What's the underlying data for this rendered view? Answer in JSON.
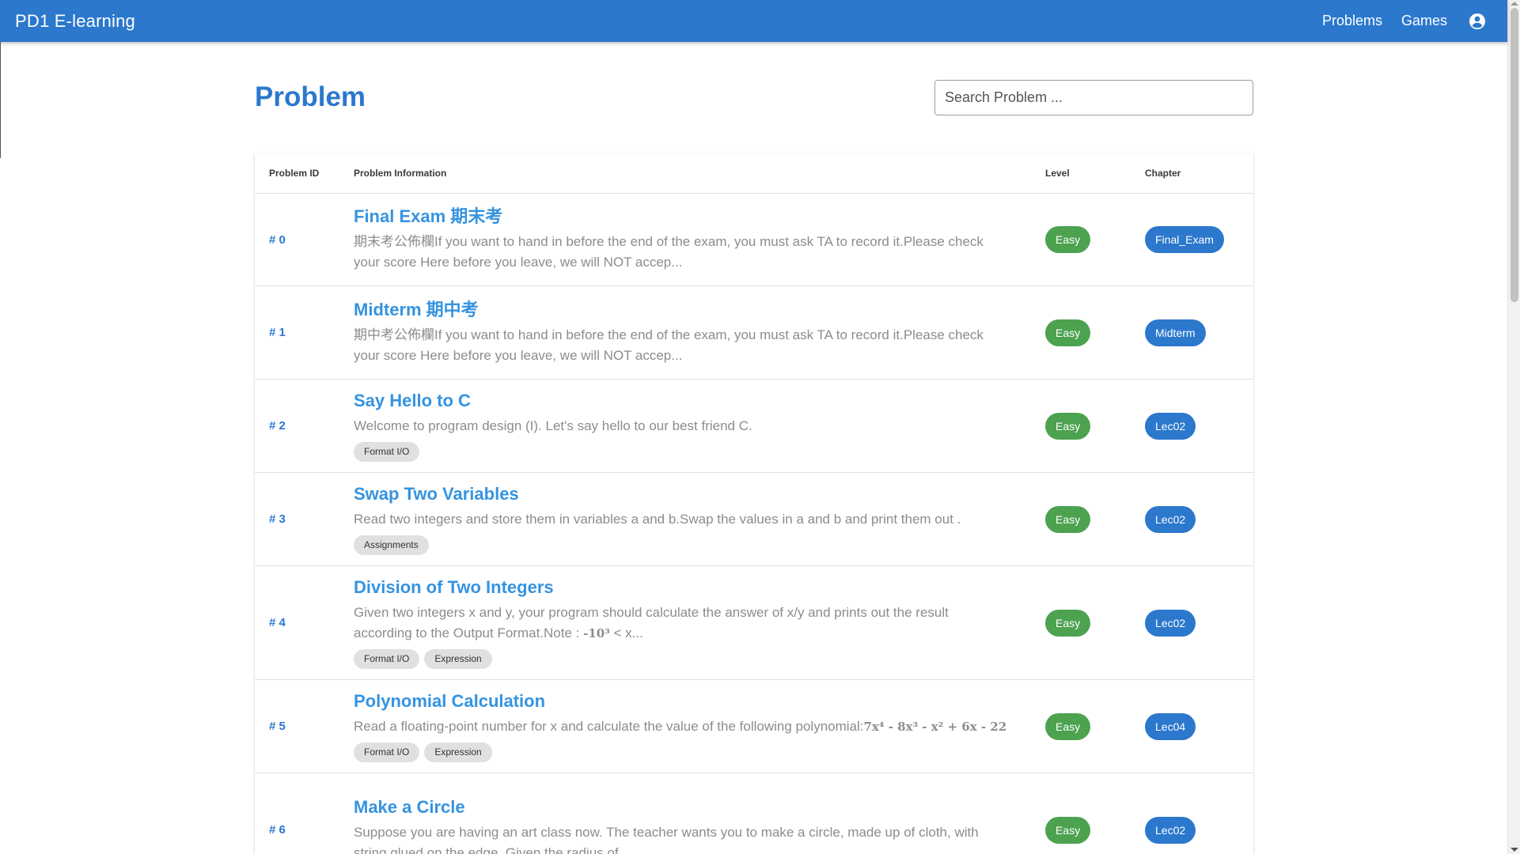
{
  "appbar": {
    "title": "PD1 E-learning",
    "nav": {
      "problems": "Problems",
      "games": "Games"
    },
    "account_icon": "account-circle-icon",
    "bg_color": "#2b78cd"
  },
  "page": {
    "title": "Problem",
    "search": {
      "placeholder": "Search Problem ...",
      "value": ""
    }
  },
  "table": {
    "headers": {
      "id": "Problem ID",
      "info": "Problem Information",
      "level": "Level",
      "chapter": "Chapter"
    },
    "rows": [
      {
        "id": "# 0",
        "title": "Final Exam 期末考",
        "desc": "期末考公佈欄If you want to hand in before the end of the exam, you must ask TA to record it.Please check your score Here before you leave, we will NOT accep...",
        "tags": [],
        "level": "Easy",
        "chapter": "Final_Exam"
      },
      {
        "id": "# 1",
        "title": "Midterm 期中考",
        "desc": "期中考公佈欄If you want to hand in before the end of the exam, you must ask TA to record it.Please check your score Here before you leave, we will NOT accep...",
        "tags": [],
        "level": "Easy",
        "chapter": "Midterm"
      },
      {
        "id": "# 2",
        "title": "Say Hello to C",
        "desc": "Welcome to program design (I). Let's say hello to our best friend C.",
        "tags": [
          "Format I/O"
        ],
        "level": "Easy",
        "chapter": "Lec02"
      },
      {
        "id": "# 3",
        "title": "Swap Two Variables",
        "desc": "Read two integers and store them in variables a and b.Swap the values in a and b and print them out .",
        "tags": [
          "Assignments"
        ],
        "level": "Easy",
        "chapter": "Lec02"
      },
      {
        "id": "# 4",
        "title": "Division of Two Integers",
        "desc_text": "Given two integers x and y, your program should calculate the answer of x/y and prints out the result according to the Output Format.Note : ",
        "desc_math": "-10³",
        "desc_tail": " < x...",
        "tags": [
          "Format I/O",
          "Expression"
        ],
        "level": "Easy",
        "chapter": "Lec02"
      },
      {
        "id": "# 5",
        "title": "Polynomial Calculation",
        "desc_text": "Read a floating-point number for x and calculate the value of the following polynomial:",
        "desc_math": "7x⁴ - 8x³ - x² + 6x - 22",
        "tags": [
          "Format I/O",
          "Expression"
        ],
        "level": "Easy",
        "chapter": "Lec04"
      },
      {
        "id": "# 6",
        "title": "Make a Circle",
        "desc": "Suppose you are having an art class now. The teacher wants you to make a circle, made up of cloth, with string glued on the edge. Given the radius of ...",
        "tags": [],
        "level": "Easy",
        "chapter": "Lec02"
      }
    ]
  },
  "colors": {
    "accent": "#2b78cd",
    "title_link": "#3593e0",
    "level_easy": "#4ca24f",
    "chapter_badge": "#2b78cd",
    "tag_bg": "#e0e0e0"
  }
}
